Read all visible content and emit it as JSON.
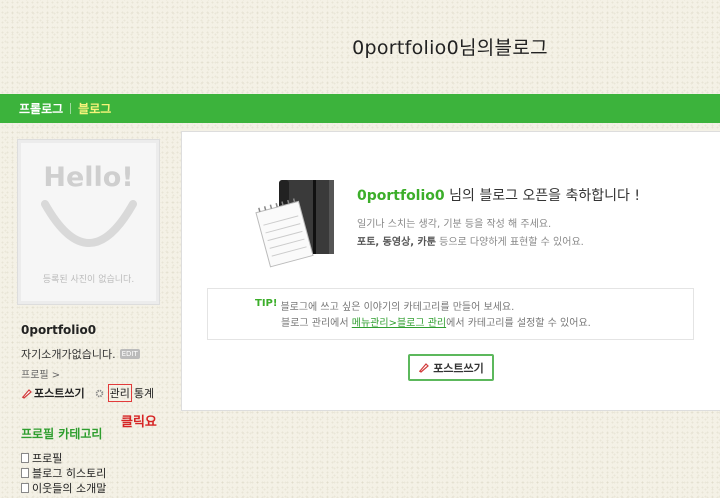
{
  "blog": {
    "title": "0portfolio0님의블로그"
  },
  "nav": {
    "tabs": [
      {
        "label": "프롤로그"
      },
      {
        "label": "블로그"
      }
    ]
  },
  "sidebar": {
    "photo_hello": "Hello!",
    "no_photo_text": "등록된 사진이 없습니다.",
    "username": "0portfolio0",
    "intro": "자기소개가없습니다.",
    "edit_badge": "EDIT",
    "profile_link": "프로필 >",
    "actions": {
      "post": "포스트쓰기",
      "manage": "관리",
      "stats": "통계"
    },
    "click_note": "클릭요",
    "category_title": "프로필 카테고리",
    "categories": [
      {
        "label": "프로필"
      },
      {
        "label": "블로그 히스토리"
      },
      {
        "label": "이웃들의 소개말"
      }
    ]
  },
  "main": {
    "welcome_user": "0portfolio0",
    "welcome_suffix": " 님의 블로그 오픈을 축하합니다 !",
    "desc1": "일기나 스치는 생각, 기분 등을 작성 해 주세요.",
    "desc2_bold": "포토, 동영상, 카툰",
    "desc2_rest": " 등으로 다양하게 표현할 수 있어요.",
    "tip_label": "TIP!",
    "tip_line1": "블로그에 쓰고 싶은 이야기의 카테고리를 만들어 보세요.",
    "tip_line2_pre": "블로그 관리에서 ",
    "tip_line2_link": "메뉴관리>블로그 관리",
    "tip_line2_post": "에서 카테고리를 설정할 수 있어요.",
    "post_button": "포스트쓰기"
  },
  "colors": {
    "nav_green": "#3cb33c",
    "accent_green": "#3cae2a",
    "highlight_red": "#e23b3b",
    "active_tab": "#f6f37a"
  },
  "icons": [
    "smile-icon",
    "pencil-icon",
    "gear-icon",
    "document-icon",
    "notebook-icon"
  ]
}
